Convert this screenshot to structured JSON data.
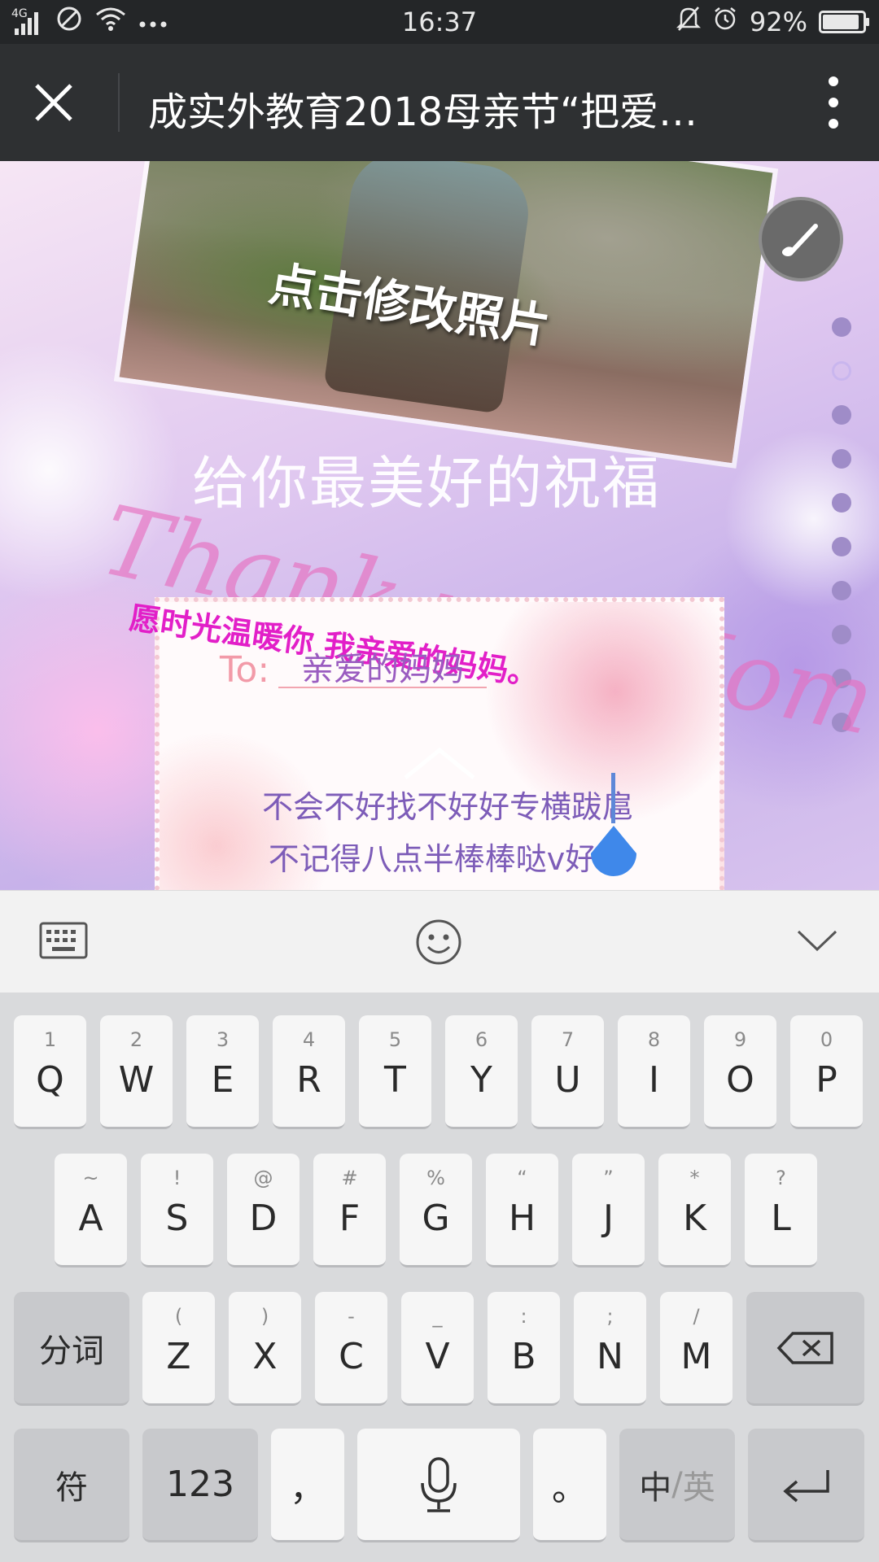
{
  "status_bar": {
    "signal": "4G",
    "time": "16:37",
    "battery": "92%",
    "battery_level": 0.92,
    "icons": [
      "signal-icon",
      "do-not-disturb-icon",
      "wifi-icon",
      "more-dots-icon",
      "bell-muted-icon",
      "alarm-icon",
      "battery-icon"
    ]
  },
  "title_bar": {
    "title": "成实外教育2018母亲节“把爱…",
    "close_icon": "close-icon",
    "more_icon": "more-vertical-icon"
  },
  "content": {
    "photo_caption": "点击修改照片",
    "blessing": "给你最美好的祝福",
    "thank_you": "Thank you Mom",
    "wish": "愿时光温暖你   我亲爱的妈妈。",
    "to_label": "To:",
    "to_value": "亲爱的妈妈",
    "message_lines": [
      "不会不好找不好好专横跋扈",
      "不记得八点半棒棒哒v好都"
    ],
    "music_icon": "music-icon",
    "page_dot_count": 10,
    "active_page_index": 1
  },
  "keyboard_toolbar": {
    "keyboard_icon": "keyboard-icon",
    "emoji_icon": "emoji-icon",
    "collapse_icon": "chevron-down-icon"
  },
  "keyboard": {
    "row1": [
      {
        "hint": "1",
        "key": "Q"
      },
      {
        "hint": "2",
        "key": "W"
      },
      {
        "hint": "3",
        "key": "E"
      },
      {
        "hint": "4",
        "key": "R"
      },
      {
        "hint": "5",
        "key": "T"
      },
      {
        "hint": "6",
        "key": "Y"
      },
      {
        "hint": "7",
        "key": "U"
      },
      {
        "hint": "8",
        "key": "I"
      },
      {
        "hint": "9",
        "key": "O"
      },
      {
        "hint": "0",
        "key": "P"
      }
    ],
    "row2": [
      {
        "hint": "~",
        "key": "A"
      },
      {
        "hint": "!",
        "key": "S"
      },
      {
        "hint": "@",
        "key": "D"
      },
      {
        "hint": "#",
        "key": "F"
      },
      {
        "hint": "%",
        "key": "G"
      },
      {
        "hint": "“",
        "key": "H"
      },
      {
        "hint": "”",
        "key": "J"
      },
      {
        "hint": "*",
        "key": "K"
      },
      {
        "hint": "?",
        "key": "L"
      }
    ],
    "row3": [
      {
        "hint": "(",
        "key": "Z"
      },
      {
        "hint": ")",
        "key": "X"
      },
      {
        "hint": "-",
        "key": "C"
      },
      {
        "hint": "_",
        "key": "V"
      },
      {
        "hint": ":",
        "key": "B"
      },
      {
        "hint": ";",
        "key": "N"
      },
      {
        "hint": "/",
        "key": "M"
      }
    ],
    "segment_label": "分词",
    "backspace_icon": "backspace-icon",
    "symbol_label": "符",
    "number_label": "123",
    "comma_label": "，",
    "mic_icon": "microphone-icon",
    "period_label": "。",
    "lang_label_cn": "中",
    "lang_label_sep": "/",
    "lang_label_en": "英",
    "enter_icon": "enter-icon"
  }
}
